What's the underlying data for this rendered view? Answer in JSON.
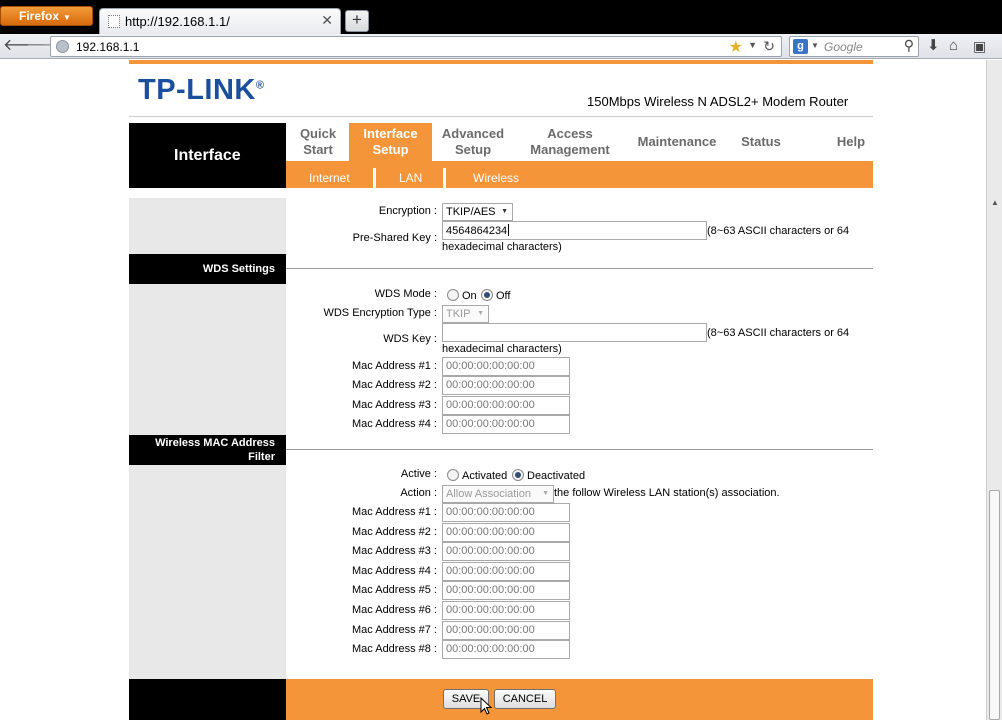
{
  "browser": {
    "app_menu_label": "Firefox",
    "tab_title": "http://192.168.1.1/",
    "new_tab_label": "+",
    "url": "192.168.1.1",
    "search_engine_letter": "g",
    "search_placeholder": "Google"
  },
  "header": {
    "logo": "TP-LINK",
    "logo_mark": "®",
    "model": "150Mbps Wireless N ADSL2+ Modem Router"
  },
  "menu": {
    "section_title": "Interface",
    "items": [
      {
        "line1": "Quick",
        "line2": "Start"
      },
      {
        "line1": "Interface",
        "line2": "Setup"
      },
      {
        "line1": "Advanced",
        "line2": "Setup"
      },
      {
        "line1": "Access",
        "line2": "Management"
      },
      {
        "line1": "Maintenance"
      },
      {
        "line1": "Status"
      },
      {
        "line1": "Help"
      }
    ],
    "active_item": "Interface Setup",
    "subitems": [
      "Internet",
      "LAN",
      "Wireless"
    ]
  },
  "security": {
    "encryption_label": "Encryption :",
    "encryption_value": "TKIP/AES",
    "psk_label": "Pre-Shared Key :",
    "psk_value": "4564864234",
    "psk_hint_1": "(8~63 ASCII characters or 64",
    "psk_hint_2": "hexadecimal characters)"
  },
  "wds": {
    "section_title": "WDS Settings",
    "mode_label": "WDS Mode :",
    "mode_on": "On",
    "mode_off": "Off",
    "mode_selected": "Off",
    "enc_type_label": "WDS Encryption Type :",
    "enc_type_value": "TKIP",
    "key_label": "WDS Key :",
    "key_value": "",
    "key_hint_1": "(8~63 ASCII characters or 64",
    "key_hint_2": "hexadecimal characters)",
    "mac_addresses": [
      {
        "label": "Mac Address #1 :",
        "value": "00:00:00:00:00:00"
      },
      {
        "label": "Mac Address #2 :",
        "value": "00:00:00:00:00:00"
      },
      {
        "label": "Mac Address #3 :",
        "value": "00:00:00:00:00:00"
      },
      {
        "label": "Mac Address #4 :",
        "value": "00:00:00:00:00:00"
      }
    ]
  },
  "mac_filter": {
    "section_title_1": "Wireless MAC Address",
    "section_title_2": "Filter",
    "active_label": "Active :",
    "activated": "Activated",
    "deactivated": "Deactivated",
    "active_selected": "Deactivated",
    "action_label": "Action :",
    "action_value": "Allow Association",
    "action_suffix": "the follow Wireless LAN station(s) association.",
    "mac_addresses": [
      {
        "label": "Mac Address #1 :",
        "value": "00:00:00:00:00:00"
      },
      {
        "label": "Mac Address #2 :",
        "value": "00:00:00:00:00:00"
      },
      {
        "label": "Mac Address #3 :",
        "value": "00:00:00:00:00:00"
      },
      {
        "label": "Mac Address #4 :",
        "value": "00:00:00:00:00:00"
      },
      {
        "label": "Mac Address #5 :",
        "value": "00:00:00:00:00:00"
      },
      {
        "label": "Mac Address #6 :",
        "value": "00:00:00:00:00:00"
      },
      {
        "label": "Mac Address #7 :",
        "value": "00:00:00:00:00:00"
      },
      {
        "label": "Mac Address #8 :",
        "value": "00:00:00:00:00:00"
      }
    ]
  },
  "footer": {
    "save_label": "SAVE",
    "cancel_label": "CANCEL"
  },
  "colors": {
    "accent_orange": "#f5953a",
    "logo_blue": "#1a4f9e",
    "sidebar_black": "#000000"
  }
}
